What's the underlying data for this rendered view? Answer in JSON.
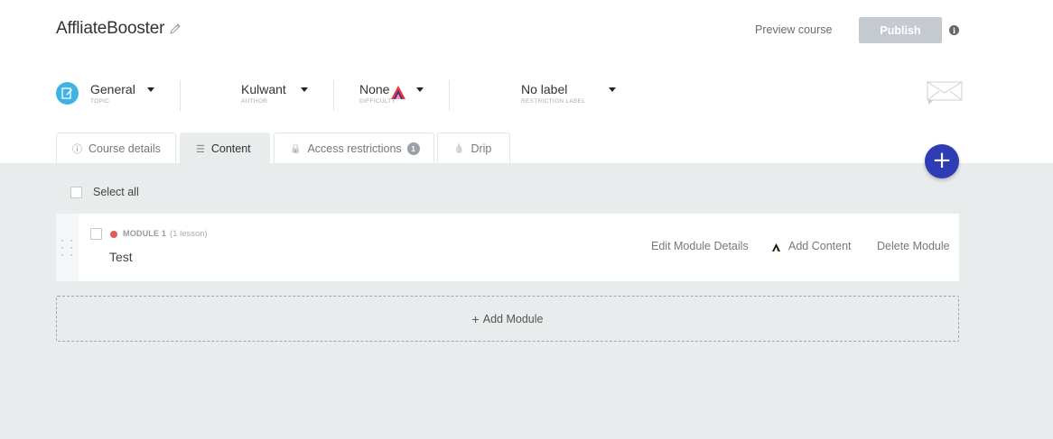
{
  "course": {
    "title": "AffliateBooster",
    "preview_label": "Preview course",
    "publish_label": "Publish",
    "info_glyph": "i"
  },
  "meta": {
    "topic": {
      "value": "General",
      "label": "TOPIC"
    },
    "author": {
      "value": "Kulwant",
      "label": "AUTHOR"
    },
    "difficulty": {
      "value": "None",
      "label": "DIFFICULTY"
    },
    "restriction": {
      "value": "No label",
      "label": "RESTRICTION LABEL"
    }
  },
  "tabs": [
    {
      "label": "Course details",
      "icon": "info-circle-icon",
      "glyph": "ⓘ"
    },
    {
      "label": "Content",
      "icon": "list-icon",
      "glyph": "☰",
      "active": true
    },
    {
      "label": "Access restrictions",
      "icon": "lock-icon",
      "glyph": "🔒",
      "badge": "1"
    },
    {
      "label": "Drip",
      "icon": "drop-icon",
      "glyph": "💧"
    }
  ],
  "content": {
    "fab_glyph": "+",
    "select_all_label": "Select all",
    "module": {
      "label": "MODULE 1",
      "count": "(1 lesson)",
      "name": "Test",
      "edit_label": "Edit Module Details",
      "add_content_label": "Add Content",
      "delete_label": "Delete Module",
      "status_color": "#e05d5d"
    },
    "add_module_glyph": "+",
    "add_module_label": "Add Module"
  },
  "colors": {
    "accent": "#2f3db5",
    "topic_icon": "#3fb3e3",
    "publish_disabled": "#c5cad1",
    "content_bg": "#e8ecec"
  }
}
